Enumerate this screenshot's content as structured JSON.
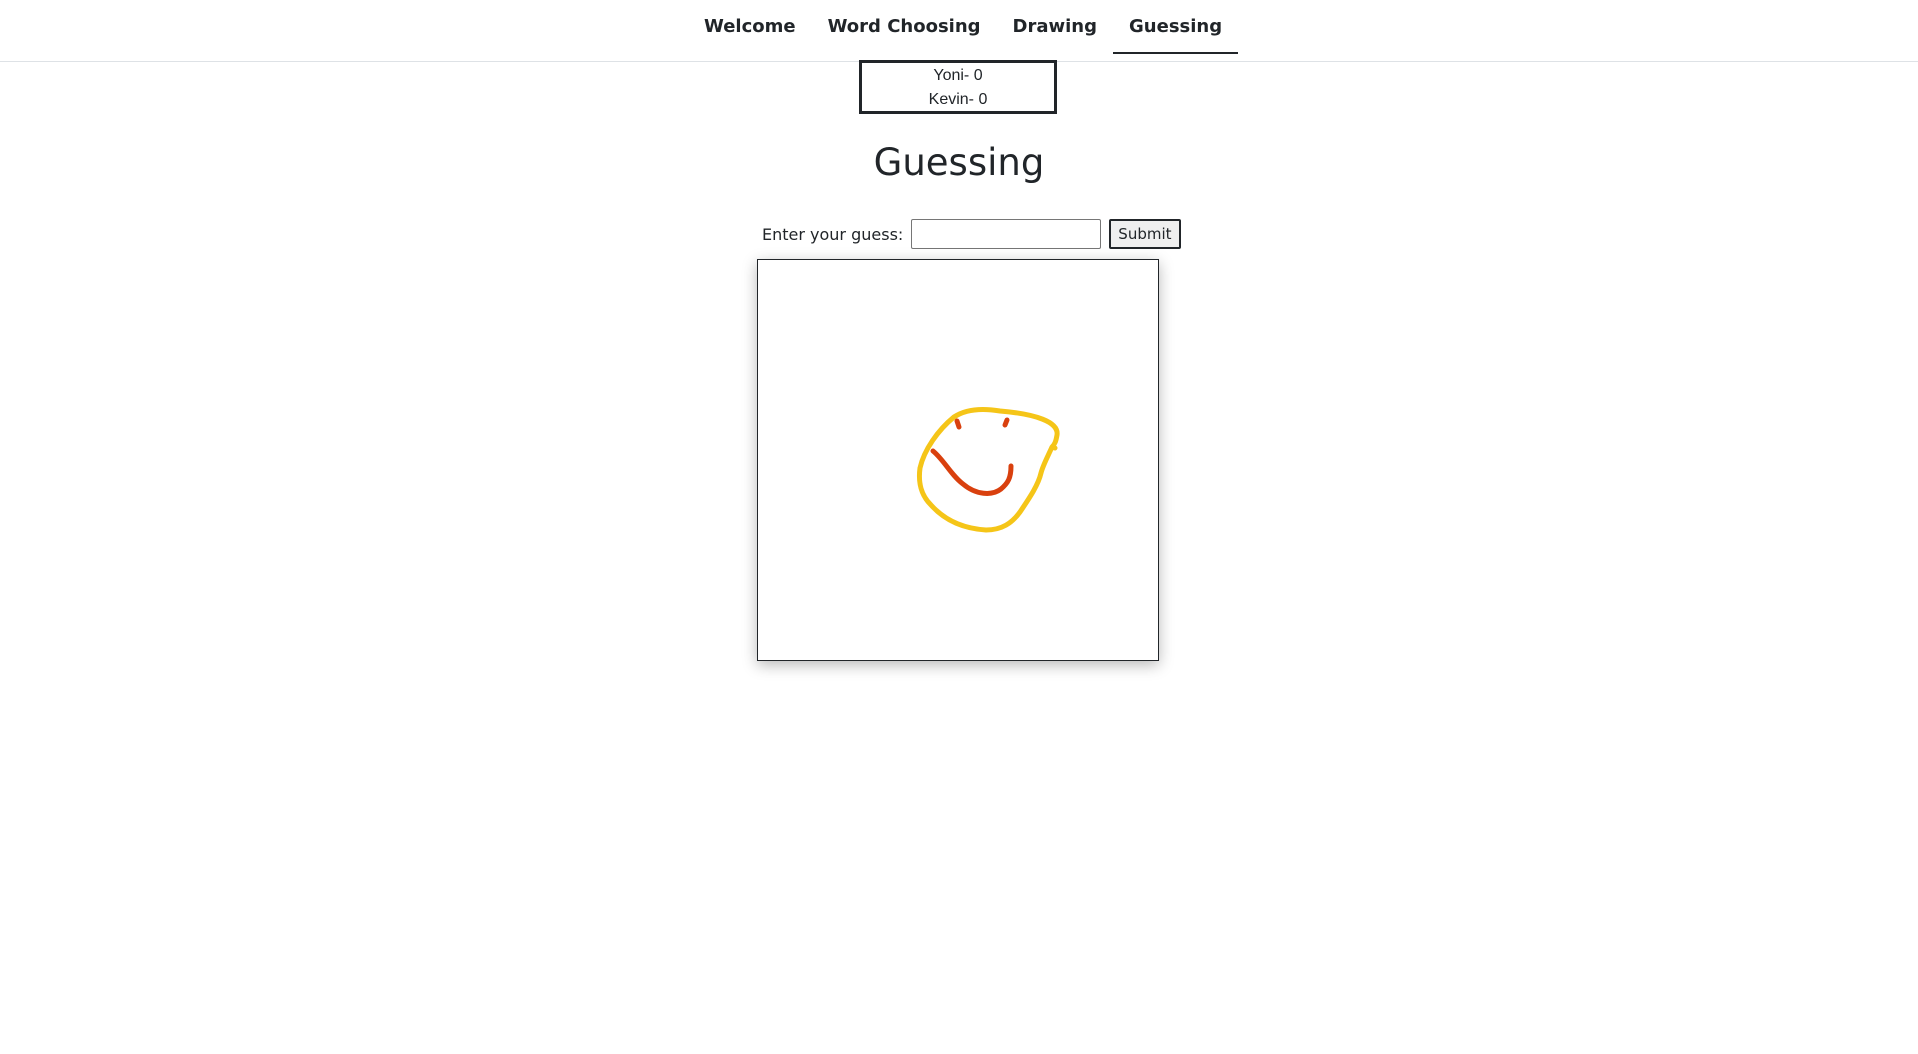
{
  "nav": {
    "tabs": [
      {
        "label": "Welcome",
        "active": false
      },
      {
        "label": "Word Choosing",
        "active": false
      },
      {
        "label": "Drawing",
        "active": false
      },
      {
        "label": "Guessing",
        "active": true
      }
    ]
  },
  "scoreboard": {
    "players": [
      {
        "text": "Yoni- 0"
      },
      {
        "text": "Kevin- 0"
      }
    ]
  },
  "page": {
    "title": "Guessing"
  },
  "guess_form": {
    "label": "Enter your guess:",
    "input_value": "",
    "submit_label": "Submit"
  },
  "drawing": {
    "face_color": "#f5c518",
    "features_color": "#d9400e"
  }
}
